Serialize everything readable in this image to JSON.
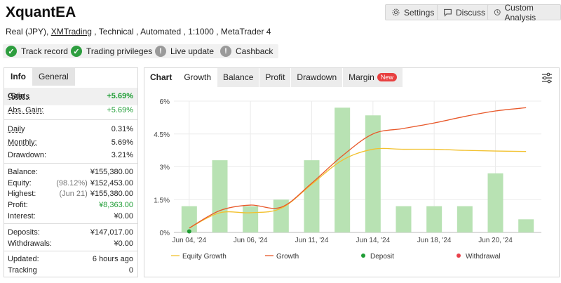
{
  "header": {
    "title": "XquantEA",
    "account_type": "Real (JPY),",
    "broker": "XMTrading",
    "details": ", Technical , Automated , 1:1000 , MetaTrader 4"
  },
  "top_buttons": {
    "settings": "Settings",
    "discuss": "Discuss",
    "custom_analysis": "Custom Analysis"
  },
  "badges": [
    {
      "label": "Track record",
      "status": "ok"
    },
    {
      "label": "Trading privileges",
      "status": "ok"
    },
    {
      "label": "Live update",
      "status": "warn"
    },
    {
      "label": "Cashback",
      "status": "warn"
    }
  ],
  "left_tabs": [
    "Info",
    "Stats",
    "General"
  ],
  "stats": {
    "gain_label": "Gain :",
    "gain_value": "+5.69%",
    "abs_gain_label": "Abs. Gain:",
    "abs_gain_value": "+5.69%",
    "daily_label": "Daily",
    "daily_value": "0.31%",
    "monthly_label": "Monthly:",
    "monthly_value": "5.69%",
    "drawdown_label": "Drawdown:",
    "drawdown_value": "3.21%",
    "balance_label": "Balance:",
    "balance_value": "¥155,380.00",
    "equity_label": "Equity:",
    "equity_pct": "(98.12%)",
    "equity_value": "¥152,453.00",
    "highest_label": "Highest:",
    "highest_date": "(Jun 21)",
    "highest_value": "¥155,380.00",
    "profit_label": "Profit:",
    "profit_value": "¥8,363.00",
    "interest_label": "Interest:",
    "interest_value": "¥0.00",
    "deposits_label": "Deposits:",
    "deposits_value": "¥147,017.00",
    "withdrawals_label": "Withdrawals:",
    "withdrawals_value": "¥0.00",
    "updated_label": "Updated:",
    "updated_value": "6 hours ago",
    "tracking_label": "Tracking",
    "tracking_value": "0"
  },
  "chart_tabs": {
    "chart": "Chart",
    "growth": "Growth",
    "balance": "Balance",
    "profit": "Profit",
    "drawdown": "Drawdown",
    "margin": "Margin",
    "margin_badge": "New"
  },
  "chart_data": {
    "type": "bar",
    "y_ticks": [
      "0%",
      "1.5%",
      "3%",
      "4.5%",
      "6%"
    ],
    "ylim": [
      0,
      6
    ],
    "x_tick_labels": [
      "Jun 04, '24",
      "Jun 06, '24",
      "Jun 11, '24",
      "Jun 14, '24",
      "Jun 18, '24",
      "Jun 20, '24"
    ],
    "x_tick_index": [
      0,
      2,
      4,
      6,
      8,
      10
    ],
    "bars": [
      1.2,
      3.3,
      1.2,
      1.5,
      3.3,
      5.7,
      5.35,
      1.2,
      1.2,
      1.2,
      2.7,
      0.6
    ],
    "series": [
      {
        "name": "Equity Growth",
        "color": "#f2c12e",
        "values": [
          0.2,
          0.9,
          0.9,
          1.1,
          2.2,
          3.3,
          3.8,
          3.8,
          3.8,
          3.75,
          3.72,
          3.7
        ]
      },
      {
        "name": "Growth",
        "color": "#e8582a",
        "values": [
          0.2,
          1.0,
          1.25,
          1.15,
          2.25,
          3.5,
          4.5,
          4.75,
          5.0,
          5.3,
          5.55,
          5.7
        ]
      }
    ],
    "bar_color": "#b8e2b3",
    "markers": [
      {
        "name": "Deposit",
        "color": "#1f9d35",
        "index": 0,
        "value": 0.05
      },
      {
        "name": "Withdrawal",
        "color": "#e8404a"
      }
    ]
  }
}
